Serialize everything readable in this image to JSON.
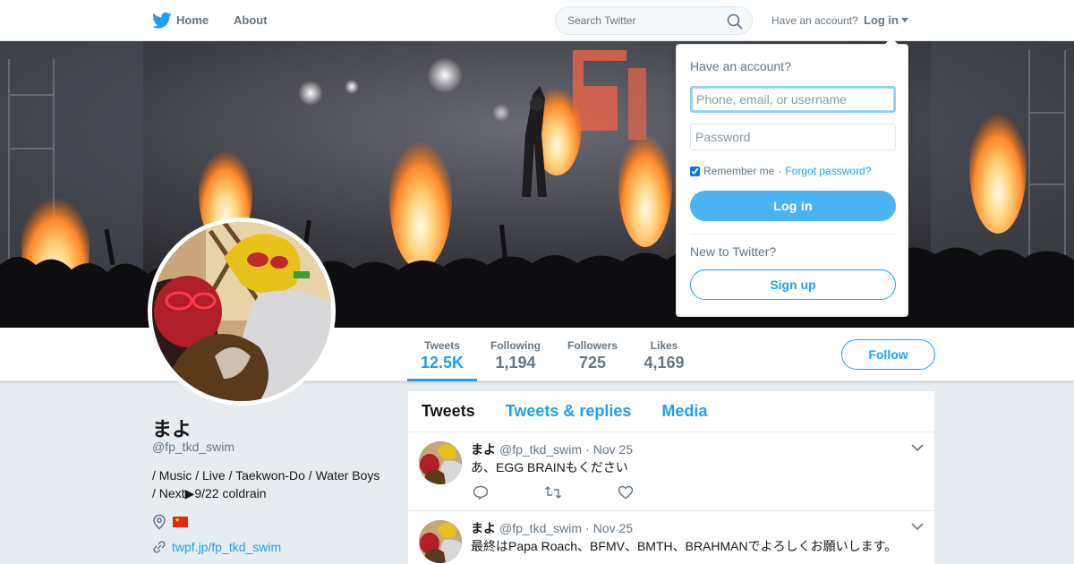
{
  "nav": {
    "logo": "twitter-bird-icon",
    "home_label": "Home",
    "about_label": "About",
    "search_placeholder": "Search Twitter",
    "have_account": "Have an account?",
    "login_label": "Log in"
  },
  "profile": {
    "name": "まよ",
    "handle": "@fp_tkd_swim",
    "bio_line1": "/ Music / Live / Taekwon-Do / Water Boys",
    "bio_line2": "/ Next▶9/22 coldrain",
    "location_flag": "🇨🇳",
    "url": "twpf.jp/fp_tkd_swim"
  },
  "stats": [
    {
      "label": "Tweets",
      "value": "12.5K",
      "active": true
    },
    {
      "label": "Following",
      "value": "1,194",
      "active": false
    },
    {
      "label": "Followers",
      "value": "725",
      "active": false
    },
    {
      "label": "Likes",
      "value": "4,169",
      "active": false
    }
  ],
  "follow_label": "Follow",
  "timeline": {
    "tabs": [
      "Tweets",
      "Tweets & replies",
      "Media"
    ],
    "tweets": [
      {
        "name": "まよ",
        "handle": "@fp_tkd_swim",
        "sep": "·",
        "date": "Nov 25",
        "text": "あ、EGG BRAINもください"
      },
      {
        "name": "まよ",
        "handle": "@fp_tkd_swim",
        "sep": "·",
        "date": "Nov 25",
        "text": "最終はPapa Roach、BFMV、BMTH、BRAHMANでよろしくお願いします。"
      }
    ]
  },
  "login_dropdown": {
    "title": "Have an account?",
    "user_placeholder": "Phone, email, or username",
    "password_placeholder": "Password",
    "remember_label": "Remember me",
    "dot": "·",
    "forgot_label": "Forgot password?",
    "remember_checked": true,
    "login_button": "Log in",
    "new_prompt": "New to Twitter?",
    "signup_button": "Sign up"
  },
  "colors": {
    "accent": "#1da1f2",
    "login_button": "#4ab3f4",
    "muted_text": "#657786",
    "page_bg": "#e6ecf0"
  }
}
